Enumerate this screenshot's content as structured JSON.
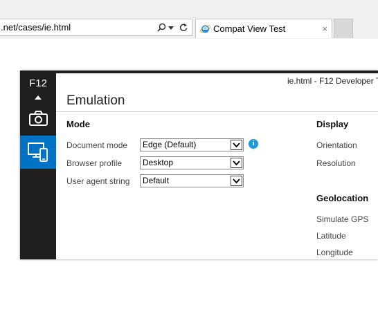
{
  "browser": {
    "address_text": ".net/cases/ie.html",
    "search_icon": "search-icon",
    "dropdown_icon": "chevron-down-icon",
    "refresh_icon": "refresh-icon",
    "tab_title": "Compat View Test",
    "tab_close": "×"
  },
  "devtools": {
    "f12_label": "F12",
    "window_title": "ie.html - F12 Developer T",
    "panel_title": "Emulation",
    "accent_color": "#0072c6",
    "mode": {
      "heading": "Mode",
      "rows": [
        {
          "label": "Document mode",
          "value": "Edge (Default)"
        },
        {
          "label": "Browser profile",
          "value": "Desktop"
        },
        {
          "label": "User agent string",
          "value": "Default"
        }
      ]
    },
    "display": {
      "heading": "Display",
      "rows": [
        "Orientation",
        "Resolution"
      ]
    },
    "geolocation": {
      "heading": "Geolocation",
      "rows": [
        "Simulate GPS",
        "Latitude",
        "Longitude"
      ]
    },
    "info_glyph": "i"
  }
}
